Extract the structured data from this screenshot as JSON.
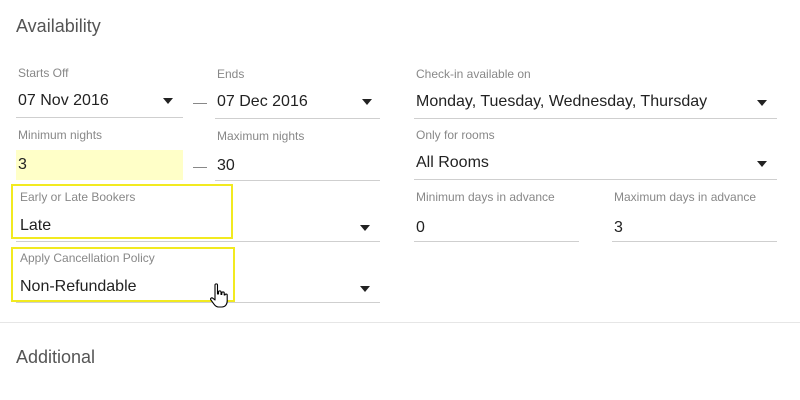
{
  "availability": {
    "title": "Availability",
    "starts_off": {
      "label": "Starts Off",
      "value": "07 Nov 2016"
    },
    "ends": {
      "label": "Ends",
      "value": "07 Dec 2016"
    },
    "checkin": {
      "label": "Check-in available on",
      "value": "Monday, Tuesday, Wednesday, Thursday"
    },
    "min_nights": {
      "label": "Minimum nights",
      "value": "3"
    },
    "max_nights": {
      "label": "Maximum nights",
      "value": "30"
    },
    "rooms": {
      "label": "Only for rooms",
      "value": "All Rooms"
    },
    "bookers": {
      "label": "Early or Late Bookers",
      "value": "Late"
    },
    "min_days": {
      "label": "Minimum days in advance",
      "value": "0"
    },
    "max_days": {
      "label": "Maximum days in advance",
      "value": "3"
    },
    "cancellation": {
      "label": "Apply Cancellation Policy",
      "value": "Non-Refundable"
    }
  },
  "additional": {
    "title": "Additional"
  },
  "colors": {
    "highlight_border": "#f2ea20",
    "highlight_fill": "#ffffc8"
  },
  "icons": {
    "dropdown": "caret-down-icon",
    "cursor": "hand-pointer-icon"
  }
}
